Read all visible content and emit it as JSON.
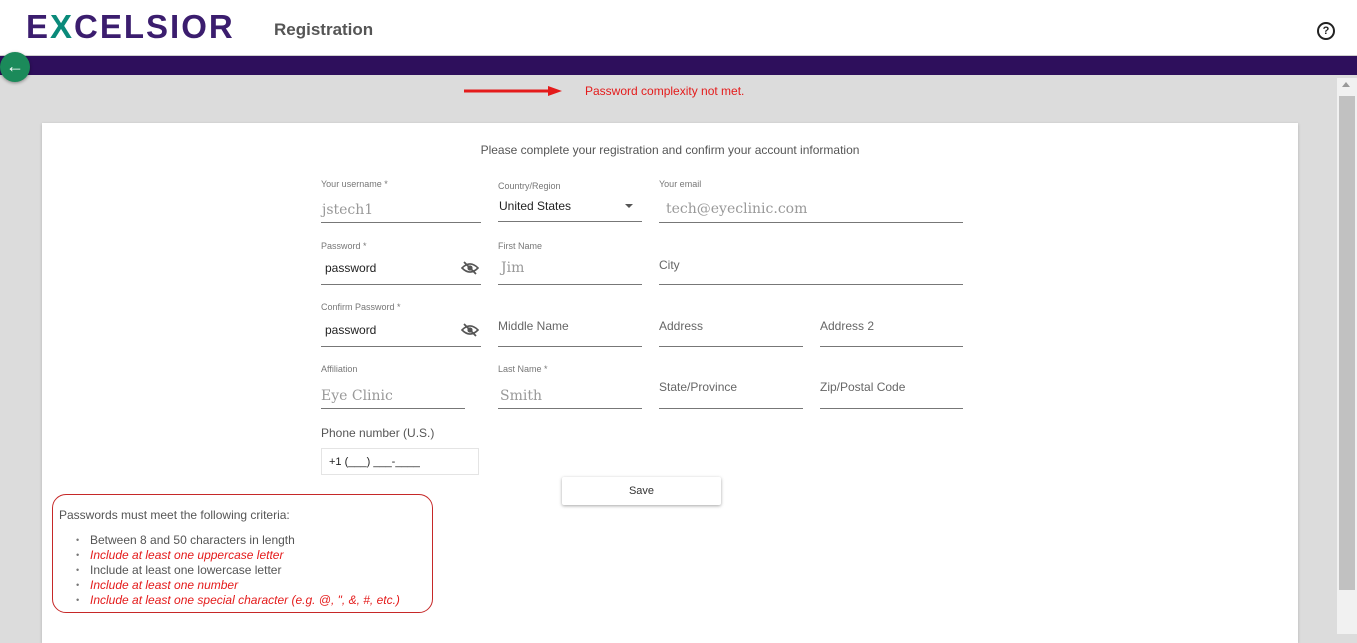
{
  "header": {
    "logo_pre": "E",
    "logo_x": "X",
    "logo_post": "CELSIOR",
    "title": "Registration",
    "help_icon": "?"
  },
  "back_icon": "←",
  "error": {
    "message": "Password complexity not met."
  },
  "intro": "Please complete your registration and confirm your account information",
  "form": {
    "username": {
      "label": "Your username *",
      "value": "jstech1"
    },
    "country": {
      "label": "Country/Region",
      "value": "United States"
    },
    "email": {
      "label": "Your email",
      "value": "tech@eyeclinic.com"
    },
    "password": {
      "label": "Password *",
      "value": "password"
    },
    "first_name": {
      "label": "First Name",
      "value": "Jim"
    },
    "city": {
      "placeholder": "City"
    },
    "confirm_password": {
      "label": "Confirm Password *",
      "value": "password"
    },
    "middle_name": {
      "placeholder": "Middle Name"
    },
    "address": {
      "placeholder": "Address"
    },
    "address2": {
      "placeholder": "Address 2"
    },
    "affiliation": {
      "label": "Affiliation",
      "value": "Eye Clinic"
    },
    "last_name": {
      "label": "Last Name *",
      "value": "Smith"
    },
    "state": {
      "placeholder": "State/Province"
    },
    "zip": {
      "placeholder": "Zip/Postal Code"
    },
    "phone": {
      "label": "Phone number (U.S.)",
      "value": "+1 (___) ___-____"
    }
  },
  "save_label": "Save",
  "criteria": {
    "heading": "Passwords must meet the following criteria:",
    "items": [
      {
        "text": "Between 8 and 50 characters in length",
        "met": true
      },
      {
        "text": "Include at least one uppercase letter",
        "met": false
      },
      {
        "text": "Include at least one lowercase letter",
        "met": true
      },
      {
        "text": "Include at least one number",
        "met": false
      },
      {
        "text": "Include at least one special character (e.g. @, \", &, #, etc.)",
        "met": false
      }
    ]
  },
  "colors": {
    "brand_purple": "#2e0f5c",
    "error_red": "#e41b1b",
    "back_green": "#1b8a5a"
  }
}
